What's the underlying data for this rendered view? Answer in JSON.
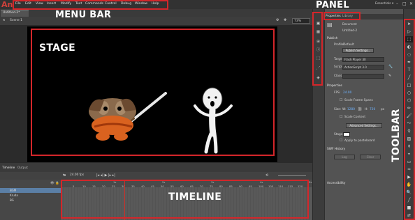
{
  "app": {
    "logo": "An",
    "workspace": "Essentials ▾"
  },
  "menu": [
    "File",
    "Edit",
    "View",
    "Insert",
    "Modify",
    "Text",
    "Commands",
    "Control",
    "Debug",
    "Window",
    "Help"
  ],
  "document": {
    "tab": "Untitled-2*",
    "scene": "Scene 1",
    "zoom": "73%"
  },
  "timeline": {
    "tabs": [
      "Timeline",
      "Output"
    ],
    "fps": "24.00 fps",
    "frame_ticks": [
      "5",
      "10",
      "15",
      "20",
      "25",
      "30",
      "35",
      "40",
      "45",
      "50",
      "55",
      "60",
      "65",
      "70",
      "75",
      "80",
      "85",
      "90",
      "95",
      "100",
      "105",
      "110",
      "115",
      "120"
    ],
    "time_ticks": [
      "1s",
      "2s",
      "3s",
      "4s",
      "5s"
    ],
    "layers": [
      "BGM",
      "Kruda",
      "BG"
    ]
  },
  "properties": {
    "tabs": [
      "Properties",
      "Library"
    ],
    "type": "Document",
    "name": "Untitled-2",
    "publish_section": "Publish",
    "profile_label": "Profile:",
    "profile_value": "Default",
    "publish_settings": "Publish Settings...",
    "target_label": "Target:",
    "target_value": "Flash Player 30",
    "script_label": "Script:",
    "script_value": "ActionScript 3.0",
    "class_label": "Class:",
    "properties_section": "Properties",
    "fps_label": "FPS:",
    "fps_value": "24.00",
    "scale_frame_spans": "Scale Frame Spans",
    "size_label": "Size:",
    "width_label": "W:",
    "width_value": "1280",
    "height_label": "H:",
    "height_value": "720",
    "px_label": "px",
    "scale_content": "Scale Content",
    "advanced_settings": "Advanced Settings...",
    "stage_label": "Stage:",
    "apply_pasteboard": "Apply to pasteboard",
    "swf_section": "SWF History",
    "log_label": "Log",
    "clear_label": "Clear",
    "accessibility_section": "Accessibility"
  },
  "annotations": {
    "menu_bar": "MENU BAR",
    "panel": "PANEL",
    "stage": "STAGE",
    "toolbar": "TOOLBAR",
    "timeline": "TIMELINE"
  },
  "colors": {
    "annotation_red": "#d4262a",
    "stage": "#000000",
    "brand": "#d0413b"
  }
}
